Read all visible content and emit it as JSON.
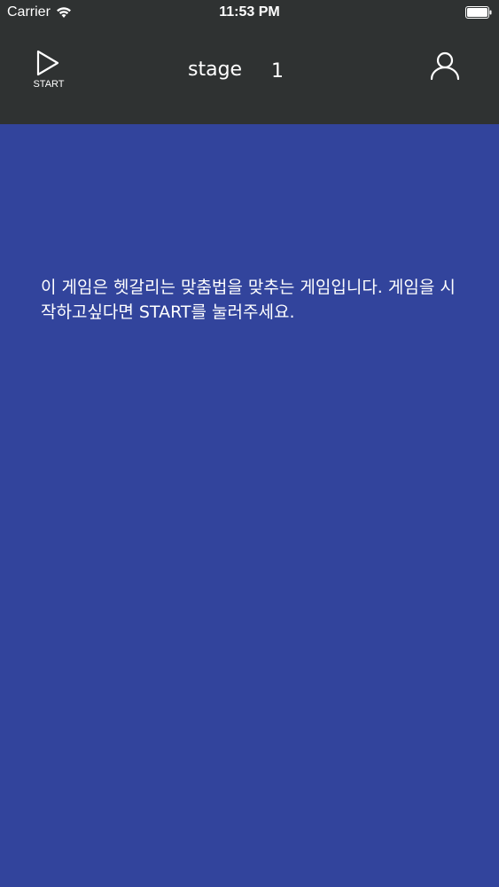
{
  "status_bar": {
    "carrier": "Carrier",
    "time": "11:53 PM",
    "wifi_icon": "wifi-icon",
    "battery_icon": "battery-icon"
  },
  "nav": {
    "start_icon": "play-icon",
    "start_label": "START",
    "stage_label": "stage",
    "stage_value": "1",
    "user_icon": "user-icon"
  },
  "main": {
    "description": "이 게임은 헷갈리는 맞춤법을 맞추는 게임입니다. 게임을 시작하고싶다면 START를 눌러주세요."
  },
  "colors": {
    "header_bg": "#2f3232",
    "content_bg": "#32449c",
    "text": "#ffffff"
  }
}
